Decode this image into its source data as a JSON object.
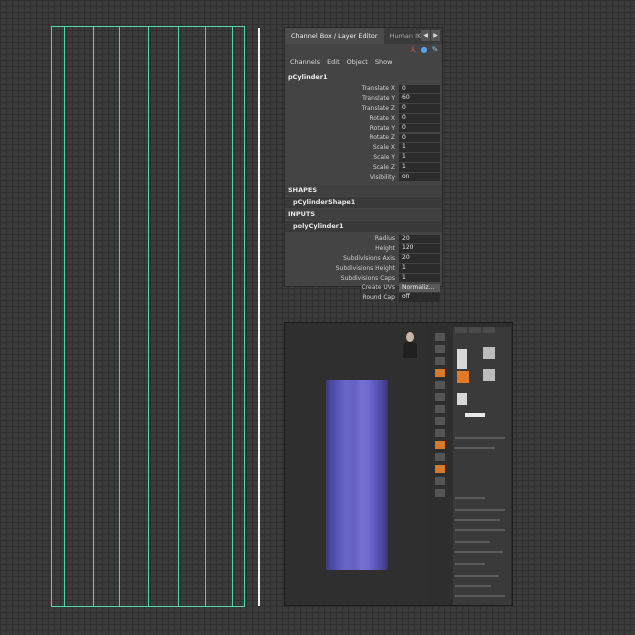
{
  "channel_box": {
    "tabs": [
      "Channel Box / Layer Editor",
      "Human IK"
    ],
    "menu": [
      "Channels",
      "Edit",
      "Object",
      "Show"
    ],
    "node": "pCylinder1",
    "transform_attrs": [
      {
        "label": "Translate X",
        "value": "0"
      },
      {
        "label": "Translate Y",
        "value": "60"
      },
      {
        "label": "Translate Z",
        "value": "0"
      },
      {
        "label": "Rotate X",
        "value": "0"
      },
      {
        "label": "Rotate Y",
        "value": "0"
      },
      {
        "label": "Rotate Z",
        "value": "0"
      },
      {
        "label": "Scale X",
        "value": "1"
      },
      {
        "label": "Scale Y",
        "value": "1"
      },
      {
        "label": "Scale Z",
        "value": "1"
      },
      {
        "label": "Visibility",
        "value": "on"
      }
    ],
    "shapes_header": "SHAPES",
    "shape_node": "pCylinderShape1",
    "inputs_header": "INPUTS",
    "input_node": "polyCylinder1",
    "input_attrs": [
      {
        "label": "Radius",
        "value": "20"
      },
      {
        "label": "Height",
        "value": "120"
      },
      {
        "label": "Subdivisions Axis",
        "value": "20"
      },
      {
        "label": "Subdivisions Height",
        "value": "1"
      },
      {
        "label": "Subdivisions Caps",
        "value": "1"
      },
      {
        "label": "Create UVs",
        "value": "Normaliz..."
      },
      {
        "label": "Round Cap",
        "value": "off"
      }
    ]
  },
  "colors": {
    "wireframe": "#4fd3a8",
    "cylinder": "#6a67c8",
    "accent": "#d77a2a"
  },
  "icons": [
    "arrow-left-icon",
    "arrow-right-icon",
    "axes-icon",
    "sphere-icon",
    "pencil-icon"
  ]
}
